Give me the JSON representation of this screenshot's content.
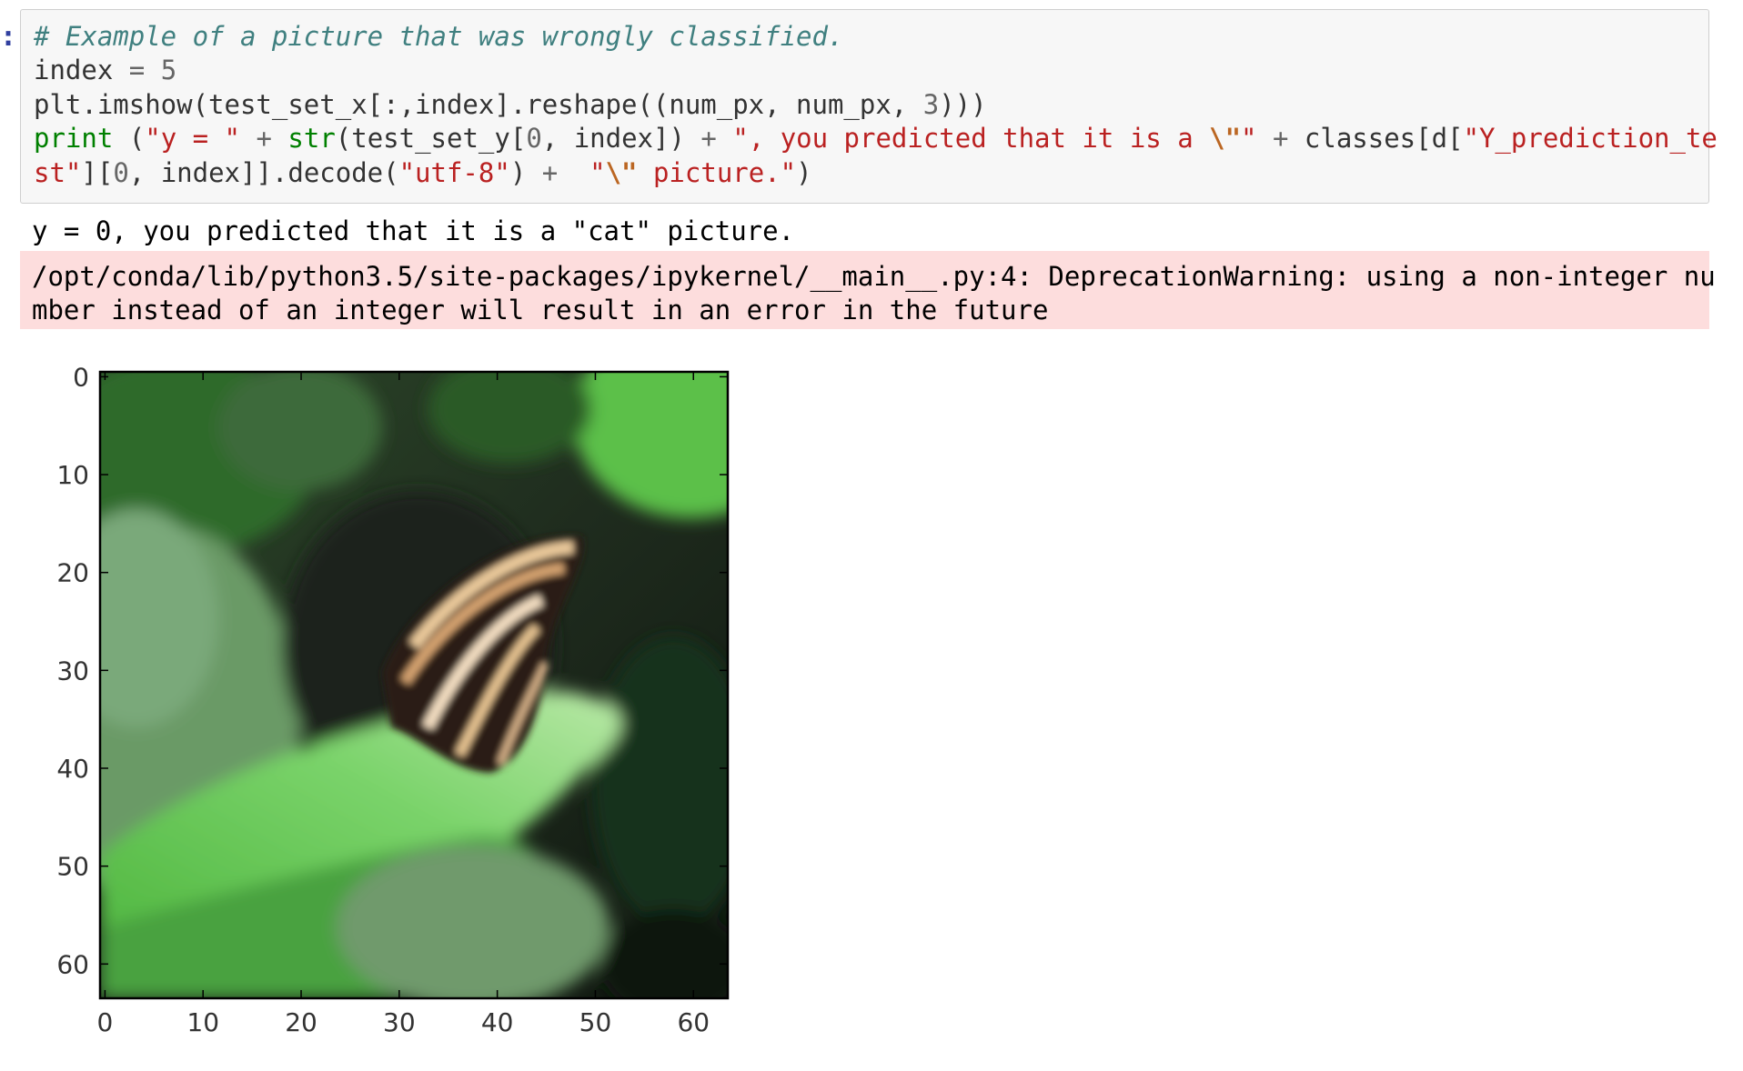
{
  "cell": {
    "prompt": ":",
    "code_lines": [
      [
        {
          "t": "com",
          "v": "# Example of a picture that was wrongly classified."
        }
      ],
      [
        {
          "t": "txt",
          "v": "index "
        },
        {
          "t": "op",
          "v": "="
        },
        {
          "t": "txt",
          "v": " "
        },
        {
          "t": "num",
          "v": "5"
        }
      ],
      [
        {
          "t": "txt",
          "v": "plt.imshow(test_set_x[:,index].reshape((num_px, num_px, "
        },
        {
          "t": "num",
          "v": "3"
        },
        {
          "t": "txt",
          "v": ")))"
        }
      ],
      [
        {
          "t": "kw",
          "v": "print"
        },
        {
          "t": "txt",
          "v": " ("
        },
        {
          "t": "str",
          "v": "\"y = \""
        },
        {
          "t": "txt",
          "v": " "
        },
        {
          "t": "op",
          "v": "+"
        },
        {
          "t": "txt",
          "v": " "
        },
        {
          "t": "kw",
          "v": "str"
        },
        {
          "t": "txt",
          "v": "(test_set_y["
        },
        {
          "t": "num",
          "v": "0"
        },
        {
          "t": "txt",
          "v": ", index]) "
        },
        {
          "t": "op",
          "v": "+"
        },
        {
          "t": "txt",
          "v": " "
        },
        {
          "t": "str",
          "v": "\", you predicted that it is a "
        },
        {
          "t": "esc",
          "v": "\\\""
        },
        {
          "t": "str",
          "v": "\""
        },
        {
          "t": "txt",
          "v": " "
        },
        {
          "t": "op",
          "v": "+"
        },
        {
          "t": "txt",
          "v": " classes[d["
        },
        {
          "t": "str",
          "v": "\"Y_prediction_te"
        }
      ],
      [
        {
          "t": "str",
          "v": "st\""
        },
        {
          "t": "txt",
          "v": "]["
        },
        {
          "t": "num",
          "v": "0"
        },
        {
          "t": "txt",
          "v": ", index]].decode("
        },
        {
          "t": "str",
          "v": "\"utf-8\""
        },
        {
          "t": "txt",
          "v": ") "
        },
        {
          "t": "op",
          "v": "+"
        },
        {
          "t": "txt",
          "v": "  "
        },
        {
          "t": "str",
          "v": "\""
        },
        {
          "t": "esc",
          "v": "\\\""
        },
        {
          "t": "str",
          "v": " picture.\""
        },
        {
          "t": "txt",
          "v": ")"
        }
      ]
    ]
  },
  "output": {
    "stdout": "y = 0, you predicted that it is a \"cat\" picture.",
    "stderr_lines": [
      "/opt/conda/lib/python3.5/site-packages/ipykernel/__main__.py:4: DeprecationWarning: using a non-integer nu",
      "mber instead of an integer will result in an error in the future"
    ]
  },
  "figure": {
    "image_description_icon": "butterfly-on-leaf-image",
    "x_ticks": [
      "0",
      "10",
      "20",
      "30",
      "40",
      "50",
      "60"
    ],
    "y_ticks": [
      "0",
      "10",
      "20",
      "30",
      "40",
      "50",
      "60"
    ],
    "colors": {
      "leaf_light": "#5fc24a",
      "leaf_dark": "#1e5a22",
      "shadow": "#141b14",
      "wing_stripe": "#e9c89a",
      "wing_dark": "#2a1a12"
    }
  }
}
